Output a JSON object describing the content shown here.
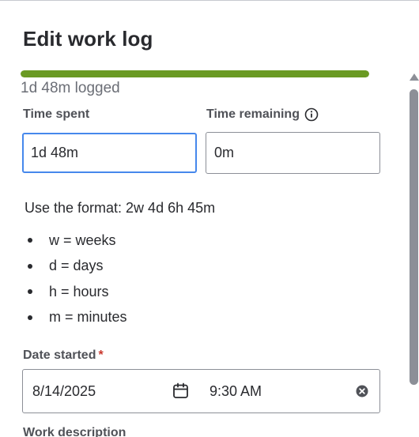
{
  "dialog": {
    "title": "Edit work log",
    "progress": {
      "fraction": 1.0,
      "color": "#6a9a23",
      "logged_text": "1d 48m logged"
    },
    "time_spent": {
      "label": "Time spent",
      "value": "1d 48m"
    },
    "time_remaining": {
      "label": "Time remaining",
      "value": "0m",
      "icon": "info-icon"
    },
    "format_help": {
      "intro": "Use the format: 2w 4d 6h 45m",
      "items": [
        "w = weeks",
        "d = days",
        "h = hours",
        "m = minutes"
      ]
    },
    "date_started": {
      "label": "Date started",
      "required_marker": "*",
      "date": "8/14/2025",
      "time": "9:30 AM",
      "calendar_icon": "calendar-icon",
      "clear_icon": "clear-icon"
    },
    "work_description": {
      "label": "Work description"
    }
  },
  "colors": {
    "accent_focus": "#4688ec",
    "required": "#c9372c",
    "progress": "#6a9a23"
  }
}
